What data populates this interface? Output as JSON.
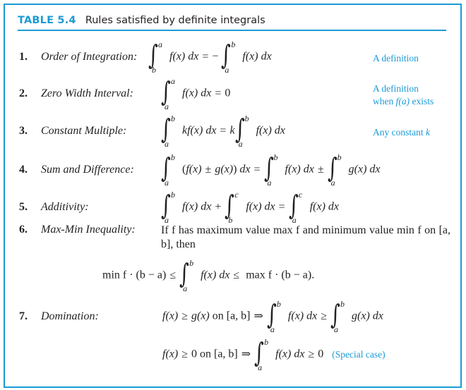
{
  "header": {
    "tag": "TABLE 5.4",
    "caption": "Rules satisfied by definite integrals"
  },
  "colors": {
    "accent": "#1b9ad6",
    "text": "#231f20"
  },
  "rules": [
    {
      "number": "1.",
      "name": "Order of Integration:",
      "formula": "∫_b^a f(x) dx = −∫_a^b f(x) dx",
      "note": "A definition"
    },
    {
      "number": "2.",
      "name": "Zero Width Interval:",
      "formula": "∫_a^a f(x) dx = 0",
      "note_line1": "A definition",
      "note_line2_prefix": "when ",
      "note_line2_var": "f(a)",
      "note_line2_suffix": " exists"
    },
    {
      "number": "3.",
      "name": "Constant Multiple:",
      "formula": "∫_a^b kf(x) dx = k∫_a^b f(x) dx",
      "note_prefix": "Any constant ",
      "note_var": "k"
    },
    {
      "number": "4.",
      "name": "Sum and Difference:",
      "formula": "∫_a^b (f(x) ± g(x)) dx = ∫_a^b f(x) dx ± ∫_a^b g(x) dx"
    },
    {
      "number": "5.",
      "name": "Additivity:",
      "formula": "∫_a^b f(x) dx + ∫_b^c f(x) dx = ∫_a^c f(x) dx"
    },
    {
      "number": "6.",
      "name": "Max-Min Inequality:",
      "text": "If f has maximum value max f and minimum value min f on [a, b], then",
      "formula": "min f · (b − a) ≤ ∫_a^b f(x) dx ≤ max f · (b − a)."
    },
    {
      "number": "7.",
      "name": "Domination:",
      "formula": "f(x) ≥ g(x) on [a, b] ⇒ ∫_a^b f(x) dx ≥ ∫_a^b g(x) dx",
      "formula_special": "f(x) ≥ 0 on [a, b] ⇒ ∫_a^b f(x) dx ≥ 0",
      "note": "(Special case)"
    }
  ],
  "sym": {
    "int": "∫",
    "a": "a",
    "b": "b",
    "c": "c",
    "fx": "f(x)",
    "gx": "g(x)",
    "dx": "dx",
    "eq": "=",
    "minus": "−",
    "plus": "+",
    "pm": "±",
    "zero": "0",
    "k": "k",
    "geq": "≥",
    "leq": "≤",
    "implies": "⇒",
    "on_ab": "on [a, b]",
    "open_paren": "(",
    "close_paren": ")",
    "min_f": "min f",
    "max_f": "max f",
    "dot": "·",
    "b_minus_a": "(b − a)",
    "b_minus_a_period": "(b − a)."
  }
}
